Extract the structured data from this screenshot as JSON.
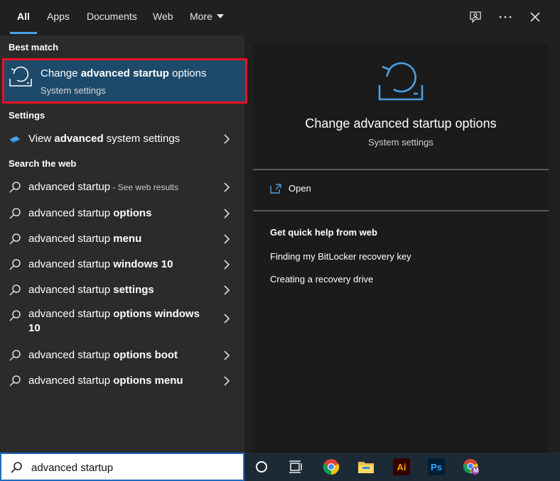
{
  "tabs": [
    {
      "label": "All"
    },
    {
      "label": "Apps"
    },
    {
      "label": "Documents"
    },
    {
      "label": "Web"
    },
    {
      "label": "More"
    }
  ],
  "sections": {
    "best_match": "Best match",
    "settings": "Settings",
    "search_web": "Search the web"
  },
  "best_match": {
    "title_pre": "Change ",
    "title_bold": "advanced startup",
    "title_post": " options",
    "subtitle": "System settings"
  },
  "settings_item": {
    "pre": "View ",
    "bold": "advanced",
    "post": " system settings"
  },
  "web_results": [
    {
      "pre": "advanced startup",
      "bold": "",
      "sub": " - See web results"
    },
    {
      "pre": "advanced startup ",
      "bold": "options",
      "sub": ""
    },
    {
      "pre": "advanced startup ",
      "bold": "menu",
      "sub": ""
    },
    {
      "pre": "advanced startup ",
      "bold": "windows 10",
      "sub": ""
    },
    {
      "pre": "advanced startup ",
      "bold": "settings",
      "sub": ""
    },
    {
      "pre": "advanced startup ",
      "bold": "options windows 10",
      "sub": ""
    },
    {
      "pre": "advanced startup ",
      "bold": "options boot",
      "sub": ""
    },
    {
      "pre": "advanced startup ",
      "bold": "options menu",
      "sub": ""
    }
  ],
  "preview": {
    "title": "Change advanced startup options",
    "subtitle": "System settings",
    "open_label": "Open",
    "help_heading": "Get quick help from web",
    "links": [
      "Finding my BitLocker recovery key",
      "Creating a recovery drive"
    ]
  },
  "search": {
    "value": "advanced startup"
  },
  "colors": {
    "accent": "#4aa0e6",
    "selection": "#1d4a6b",
    "highlight_border": "#e81123"
  },
  "taskbar_icons": [
    "cortana-icon",
    "task-view-icon",
    "chrome-icon",
    "file-explorer-icon",
    "illustrator-icon",
    "photoshop-icon",
    "chrome-profile-icon"
  ],
  "taskbar_labels": {
    "illustrator": "Ai",
    "photoshop": "Ps",
    "profile": "M"
  }
}
